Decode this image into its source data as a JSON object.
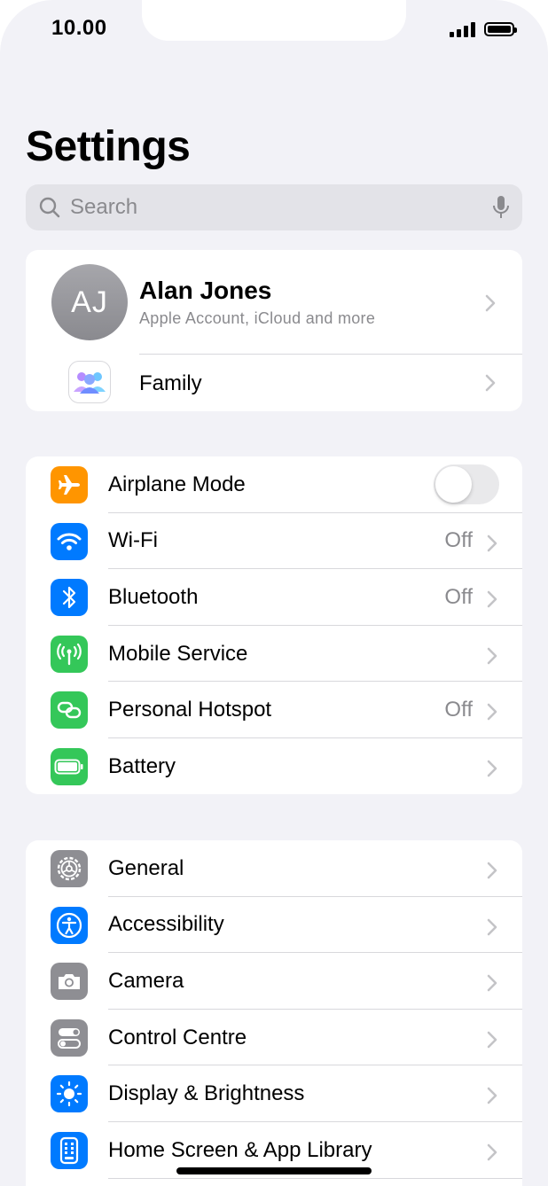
{
  "status": {
    "time": "10.00"
  },
  "page": {
    "title": "Settings"
  },
  "search": {
    "placeholder": "Search"
  },
  "profile": {
    "initials": "AJ",
    "name": "Alan Jones",
    "subtitle": "Apple Account, iCloud and more",
    "family_label": "Family"
  },
  "connectivity": {
    "airplane": {
      "label": "Airplane Mode",
      "toggle_on": false
    },
    "wifi": {
      "label": "Wi-Fi",
      "value": "Off"
    },
    "bluetooth": {
      "label": "Bluetooth",
      "value": "Off"
    },
    "mobile": {
      "label": "Mobile Service"
    },
    "hotspot": {
      "label": "Personal Hotspot",
      "value": "Off"
    },
    "battery": {
      "label": "Battery"
    }
  },
  "system": {
    "general": {
      "label": "General"
    },
    "accessibility": {
      "label": "Accessibility"
    },
    "camera": {
      "label": "Camera"
    },
    "control_centre": {
      "label": "Control Centre"
    },
    "display": {
      "label": "Display & Brightness"
    },
    "home_screen": {
      "label": "Home Screen & App Library"
    }
  },
  "colors": {
    "orange": "#ff9500",
    "blue": "#007aff",
    "green": "#34c759",
    "gray": "#8e8e93",
    "background": "#f2f2f7",
    "chevron": "#c4c4c7",
    "secondary_text": "#8a8a8e"
  },
  "icons": [
    "search-icon",
    "microphone-icon",
    "airplane-icon",
    "wifi-icon",
    "bluetooth-icon",
    "antenna-icon",
    "hotspot-icon",
    "battery-icon",
    "gear-icon",
    "accessibility-icon",
    "camera-icon",
    "control-centre-icon",
    "brightness-icon",
    "home-screen-icon",
    "family-icon",
    "chevron-right-icon"
  ]
}
